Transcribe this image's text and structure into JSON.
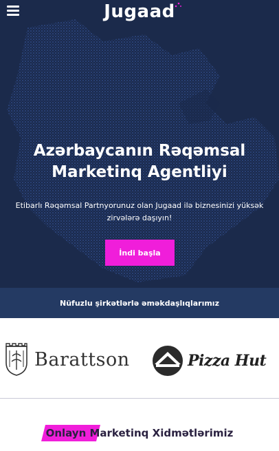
{
  "header": {
    "logo_text": "Jugaad",
    "menu_icon": "hamburger-menu-icon"
  },
  "hero": {
    "title_line1": "Azərbaycanın Rəqəmsal",
    "title_line2": "Marketinq Agentliyi",
    "subtitle_line1": "Etibarlı Rəqəmsal Partnyorunuz olan Jugaad ilə biznesinizi yüksək",
    "subtitle_line2": "zirvələrə daşıyın!",
    "cta_label": "İndi başla"
  },
  "partners": {
    "heading": "Nüfuzlu şirkətlərlə əməkdaşlıqlarımız",
    "logos": [
      {
        "name": "Barattson",
        "icon": "barattson-crest-icon"
      },
      {
        "name": "Pizza Hut",
        "icon": "pizza-hut-roof-icon"
      }
    ]
  },
  "services": {
    "title": "Onlayn Marketinq Xidmətlərimiz"
  },
  "colors": {
    "hero_bg": "#1b2a4b",
    "band_bg": "#243a63",
    "accent": "#f01eda"
  }
}
